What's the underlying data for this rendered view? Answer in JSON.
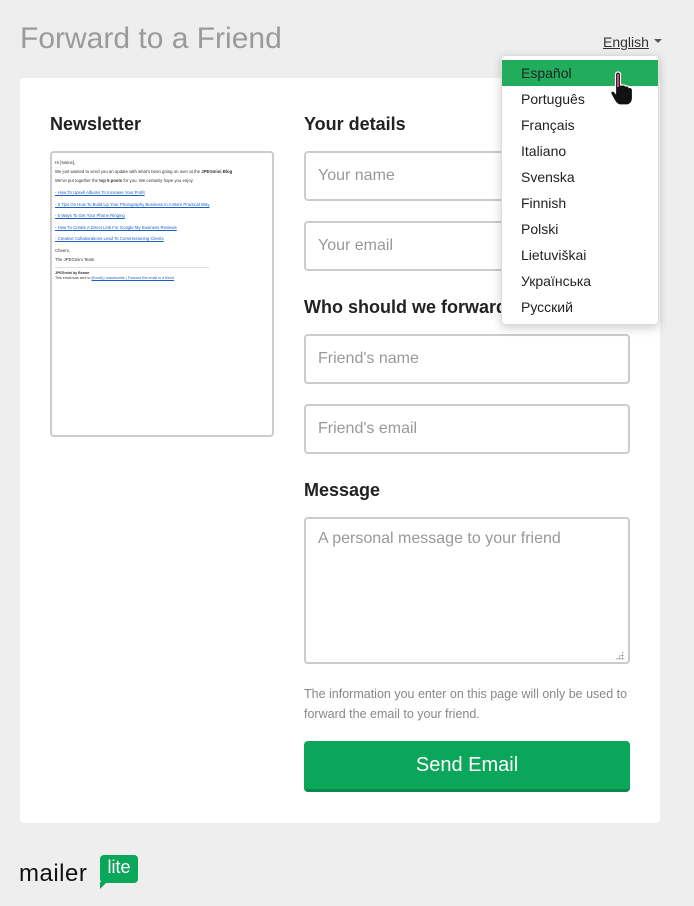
{
  "page": {
    "title": "Forward to a Friend"
  },
  "language": {
    "current": "English",
    "options": [
      "Español",
      "Português",
      "Français",
      "Italiano",
      "Svenska",
      "Finnish",
      "Polski",
      "Lietuviškai",
      "Українська",
      "Русский"
    ],
    "highlighted": "Español",
    "highlight_color": "#21ad5c"
  },
  "newsletter": {
    "heading": "Newsletter",
    "preview": {
      "greeting": "Hi [Name],",
      "intro_a": "We just wanted to send you an update with what's been going on over at the ",
      "intro_brand": "JPEGmini Blog",
      "intro_b": "We've put together the ",
      "intro_top": "top 5 posts",
      "intro_c": " for you. We certainly hope you enjoy.",
      "links": [
        "- How To Upsell Albums To Increase Your Profit",
        "- 5 Tips On How To Build Up Your Photography Business In A More Practical Way",
        "- 5 Ways To Get Your Phone Ringing",
        "- How To Create A Direct Link For Google My Business Reviews",
        "- Creative Collaborations Lead To Commissioning Clients"
      ],
      "signoff": "Cheers,",
      "team": "The JPEGmini Team",
      "footer_brand": "JPEGmini by Beamr",
      "footer_text": "This email was sent to ",
      "footer_links": "[Email] | unsubscribe | Forward this email to a friend"
    }
  },
  "details": {
    "heading": "Your details",
    "name_placeholder": "Your name",
    "email_placeholder": "Your email"
  },
  "forward": {
    "heading": "Who should we forward",
    "friend_name_placeholder": "Friend's name",
    "friend_email_placeholder": "Friend's email"
  },
  "message": {
    "heading": "Message",
    "placeholder": "A personal message to your friend"
  },
  "disclaimer": "The information you enter on this page will only be used to forward the email to your friend.",
  "send_button": "Send Email",
  "logo": {
    "word": "mailer",
    "badge": "lite",
    "brand_color": "#0aa65a"
  }
}
